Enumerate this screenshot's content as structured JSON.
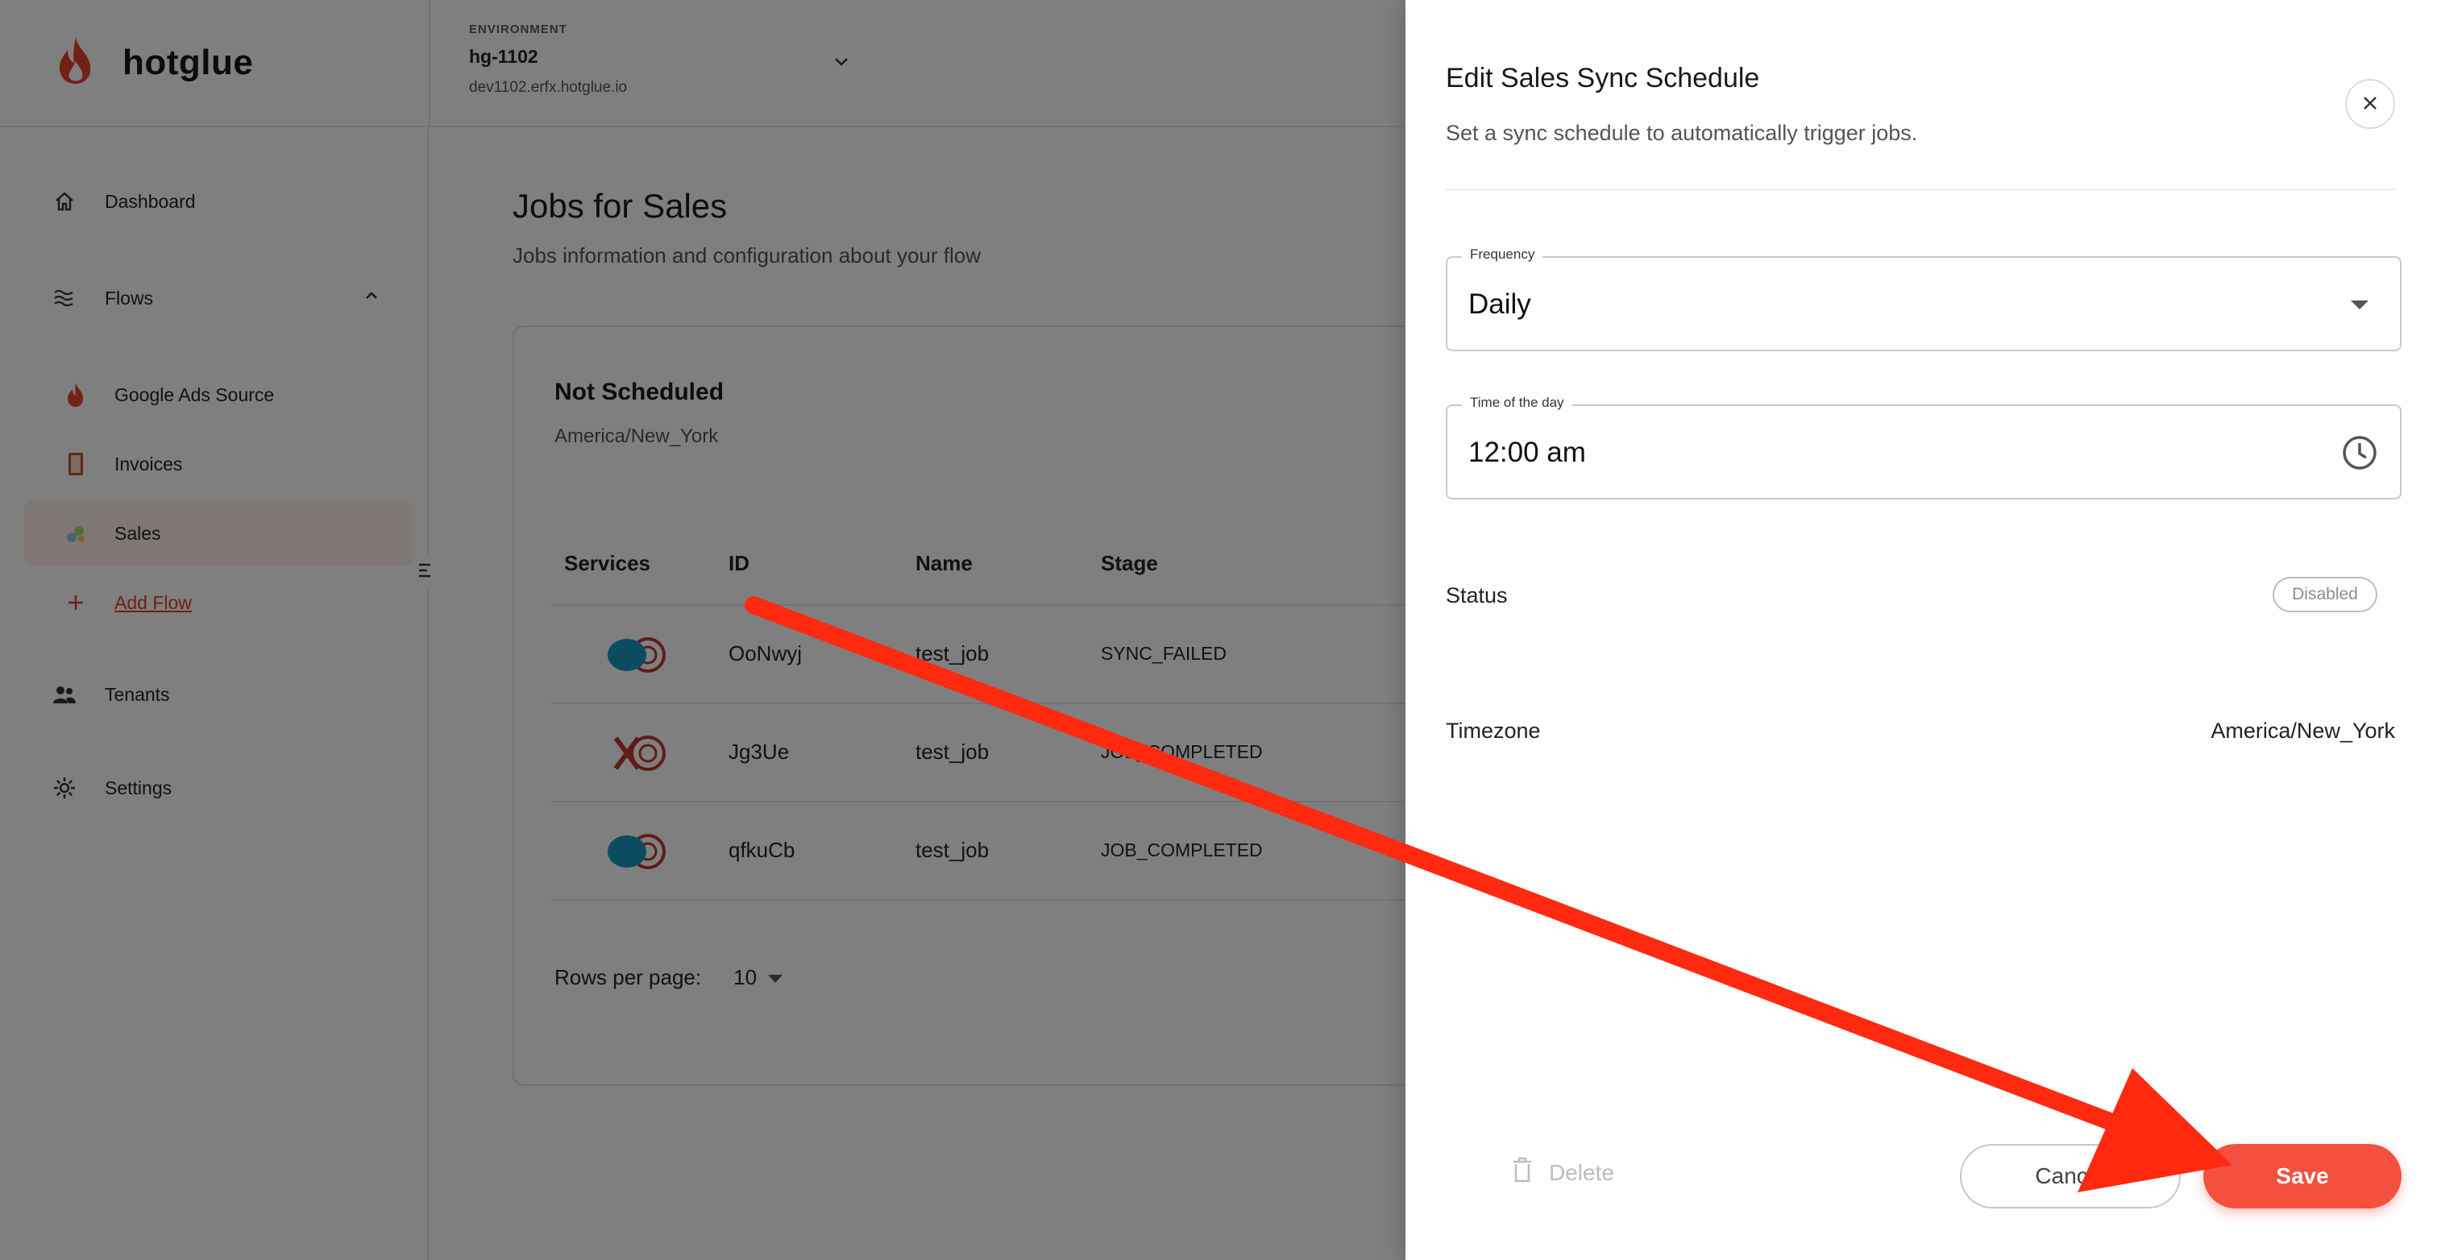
{
  "brand": {
    "name": "hotglue"
  },
  "environment": {
    "label": "ENVIRONMENT",
    "name": "hg-1102",
    "url": "dev1102.erfx.hotglue.io"
  },
  "sidebar": {
    "items": [
      {
        "label": "Dashboard",
        "icon": "home-icon"
      },
      {
        "label": "Flows",
        "icon": "waves-icon"
      },
      {
        "label": "Google Ads Source",
        "icon": "flame-icon"
      },
      {
        "label": "Invoices",
        "icon": "book-icon"
      },
      {
        "label": "Sales",
        "icon": "sales-icon"
      },
      {
        "label": "Add Flow",
        "icon": "plus-icon"
      },
      {
        "label": "Tenants",
        "icon": "people-icon"
      },
      {
        "label": "Settings",
        "icon": "gear-icon"
      }
    ]
  },
  "main": {
    "title": "Jobs for Sales",
    "subtitle": "Jobs information and configuration about your flow",
    "card": {
      "title": "Not Scheduled",
      "timezone": "America/New_York",
      "columns": [
        "Services",
        "ID",
        "Name",
        "Stage"
      ],
      "rows": [
        {
          "id": "OoNwyj",
          "name": "test_job",
          "stage": "SYNC_FAILED"
        },
        {
          "id": "Jg3Ue",
          "name": "test_job",
          "stage": "JOB_COMPLETED"
        },
        {
          "id": "qfkuCb",
          "name": "test_job",
          "stage": "JOB_COMPLETED"
        }
      ],
      "rows_per_page_label": "Rows per page:",
      "rows_per_page_value": "10"
    }
  },
  "drawer": {
    "title": "Edit Sales Sync Schedule",
    "subtitle": "Set a sync schedule to automatically trigger jobs.",
    "frequency": {
      "label": "Frequency",
      "value": "Daily"
    },
    "time": {
      "label": "Time of the day",
      "value": "12:00 am"
    },
    "status": {
      "label": "Status",
      "badge": "Disabled"
    },
    "timezone": {
      "label": "Timezone",
      "value": "America/New_York"
    },
    "buttons": {
      "delete": "Delete",
      "cancel": "Cancel",
      "save": "Save"
    }
  },
  "colors": {
    "accent": "#f4503f",
    "brand_flame": "#e8412c",
    "annotation_arrow": "#ff2a10"
  }
}
